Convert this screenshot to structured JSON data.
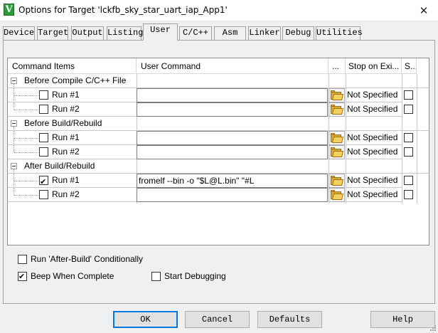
{
  "window": {
    "title": "Options for Target 'lckfb_sky_star_uart_iap_App1'",
    "app_icon_letter": "V",
    "close_glyph": "✕"
  },
  "tabs": [
    {
      "label": "Device"
    },
    {
      "label": "Target"
    },
    {
      "label": "Output"
    },
    {
      "label": "Listing"
    },
    {
      "label": "User",
      "active": true
    },
    {
      "label": "C/C++"
    },
    {
      "label": "Asm"
    },
    {
      "label": "Linker"
    },
    {
      "label": "Debug"
    },
    {
      "label": "Utilities"
    }
  ],
  "grid": {
    "headers": {
      "command_items": "Command Items",
      "user_command": "User Command",
      "browse": "...",
      "stop_on_exit": "Stop on Exi...",
      "s": "S..."
    },
    "groups": [
      {
        "label": "Before Compile C/C++ File",
        "runs": [
          {
            "label": "Run #1",
            "checked": false,
            "command": "",
            "stop": "Not Specified"
          },
          {
            "label": "Run #2",
            "checked": false,
            "command": "",
            "stop": "Not Specified"
          }
        ]
      },
      {
        "label": "Before Build/Rebuild",
        "runs": [
          {
            "label": "Run #1",
            "checked": false,
            "command": "",
            "stop": "Not Specified"
          },
          {
            "label": "Run #2",
            "checked": false,
            "command": "",
            "stop": "Not Specified"
          }
        ]
      },
      {
        "label": "After Build/Rebuild",
        "runs": [
          {
            "label": "Run #1",
            "checked": true,
            "command": "fromelf --bin -o \"$L@L.bin\" \"#L",
            "stop": "Not Specified"
          },
          {
            "label": "Run #2",
            "checked": false,
            "command": "",
            "stop": "Not Specified"
          }
        ]
      }
    ]
  },
  "options": {
    "run_after_build_conditionally": {
      "label": "Run 'After-Build' Conditionally",
      "checked": false
    },
    "beep_when_complete": {
      "label": "Beep When Complete",
      "checked": true
    },
    "start_debugging": {
      "label": "Start Debugging",
      "checked": false
    }
  },
  "buttons": {
    "ok": "OK",
    "cancel": "Cancel",
    "defaults": "Defaults",
    "help": "Help"
  },
  "icons": {
    "browse": "folder-icon",
    "expander": "collapse-icon",
    "app": "keil-app-icon"
  }
}
